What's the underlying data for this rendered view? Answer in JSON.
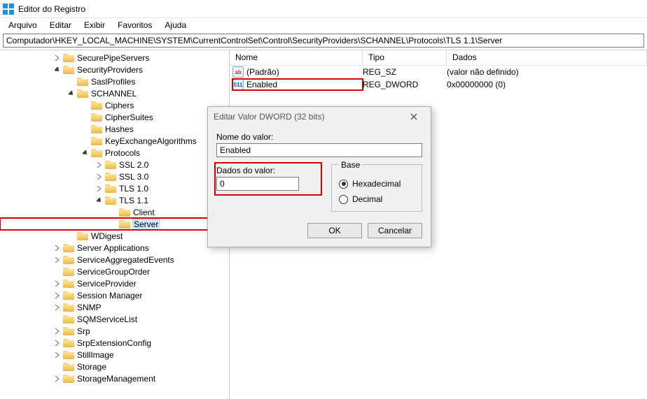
{
  "window": {
    "title": "Editor do Registro"
  },
  "menu": {
    "file": "Arquivo",
    "edit": "Editar",
    "view": "Exibir",
    "favorites": "Favoritos",
    "help": "Ajuda"
  },
  "path": "Computador\\HKEY_LOCAL_MACHINE\\SYSTEM\\CurrentControlSet\\Control\\SecurityProviders\\SCHANNEL\\Protocols\\TLS 1.1\\Server",
  "tree": {
    "securepipe": "SecurePipeServers",
    "securityproviders": "SecurityProviders",
    "saslprofiles": "SaslProfiles",
    "schannel": "SCHANNEL",
    "ciphers": "Ciphers",
    "ciphersuites": "CipherSuites",
    "hashes": "Hashes",
    "keyex": "KeyExchangeAlgorithms",
    "protocols": "Protocols",
    "ssl20": "SSL 2.0",
    "ssl30": "SSL 3.0",
    "tls10": "TLS 1.0",
    "tls11": "TLS 1.1",
    "client": "Client",
    "server": "Server",
    "wdigest": "WDigest",
    "serverapps": "Server Applications",
    "svcagg": "ServiceAggregatedEvents",
    "svcgrouporder": "ServiceGroupOrder",
    "svcprovider": "ServiceProvider",
    "sessionmgr": "Session Manager",
    "snmp": "SNMP",
    "sqmservicelist": "SQMServiceList",
    "srp": "Srp",
    "srpext": "SrpExtensionConfig",
    "stillimage": "StillImage",
    "storage": "Storage",
    "storagemgmt": "StorageManagement"
  },
  "columns": {
    "name": "Nome",
    "type": "Tipo",
    "data": "Dados"
  },
  "values": [
    {
      "icon": "ab",
      "name": "(Padrão)",
      "type": "REG_SZ",
      "data": "(valor não definido)"
    },
    {
      "icon": "dw",
      "name": "Enabled",
      "type": "REG_DWORD",
      "data": "0x00000000 (0)"
    }
  ],
  "dialog": {
    "title": "Editar Valor DWORD (32 bits)",
    "name_label": "Nome do valor:",
    "name_value": "Enabled",
    "data_label": "Dados do valor:",
    "data_value": "0",
    "base_label": "Base",
    "hex": "Hexadecimal",
    "dec": "Decimal",
    "ok": "OK",
    "cancel": "Cancelar"
  }
}
